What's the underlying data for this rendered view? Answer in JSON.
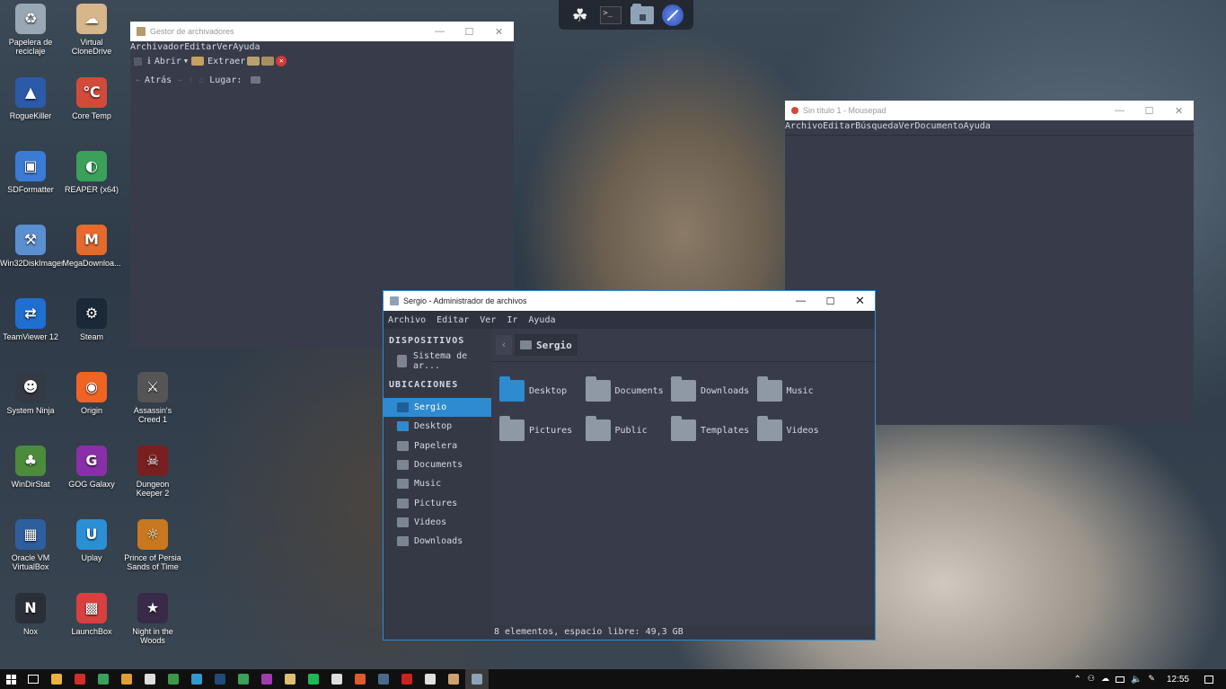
{
  "desktop_icons": [
    {
      "label": "Papelera de reciclaje",
      "icon": "recycle-bin-icon",
      "color": "#9aa7b5"
    },
    {
      "label": "Virtual CloneDrive",
      "icon": "sheep-icon",
      "color": "#d6b68a"
    },
    {
      "label": "RogueKiller",
      "icon": "roguekiller-icon",
      "color": "#2b5aa8"
    },
    {
      "label": "Core Temp",
      "icon": "thermometer-icon",
      "color": "#d24a3a"
    },
    {
      "label": "SDFormatter",
      "icon": "sd-card-icon",
      "color": "#3a7bd5"
    },
    {
      "label": "REAPER (x64)",
      "icon": "reaper-icon",
      "color": "#3aa05a"
    },
    {
      "label": "Win32DiskImager",
      "icon": "disk-imager-icon",
      "color": "#5a8fd0"
    },
    {
      "label": "MegaDownloa...",
      "icon": "mega-icon",
      "color": "#e56a2b"
    },
    {
      "label": "TeamViewer 12",
      "icon": "teamviewer-icon",
      "color": "#1f6fd1"
    },
    {
      "label": "Steam",
      "icon": "steam-icon",
      "color": "#1b2838"
    },
    {
      "label": "System Ninja",
      "icon": "ninja-icon",
      "color": "#333a44"
    },
    {
      "label": "Origin",
      "icon": "origin-icon",
      "color": "#f06423"
    },
    {
      "label": "Assassin's Creed 1",
      "icon": "assassins-creed-icon",
      "color": "#555555"
    },
    {
      "label": "WinDirStat",
      "icon": "tree-icon",
      "color": "#4c8a3c"
    },
    {
      "label": "GOG Galaxy",
      "icon": "gog-icon",
      "color": "#8a2fa8"
    },
    {
      "label": "Dungeon Keeper 2",
      "icon": "dungeon-keeper-icon",
      "color": "#7a1f1f"
    },
    {
      "label": "Oracle VM VirtualBox",
      "icon": "virtualbox-icon",
      "color": "#2d5f9e"
    },
    {
      "label": "Uplay",
      "icon": "uplay-icon",
      "color": "#2b8fd6"
    },
    {
      "label": "Prince of Persia Sands of Time",
      "icon": "prince-of-persia-icon",
      "color": "#c8781e"
    },
    {
      "label": "Nox",
      "icon": "nox-icon",
      "color": "#2a2f38"
    },
    {
      "label": "LaunchBox",
      "icon": "launchbox-icon",
      "color": "#d93f3f"
    },
    {
      "label": "Night in the Woods",
      "icon": "night-in-woods-icon",
      "color": "#3a2a4a"
    }
  ],
  "dock": [
    "swan-icon",
    "terminal-icon",
    "folder-home-icon",
    "compass-icon"
  ],
  "archive_manager": {
    "title": "Gestor de archivadores",
    "menu": "ArchivadorEditarVerAyuda",
    "toolbar": {
      "open": "Abrir",
      "extract": "Extraer"
    },
    "nav": {
      "back": "Atrás",
      "location": "Lugar:"
    }
  },
  "mousepad": {
    "title": "Sin título 1 - Mousepad",
    "menu": "ArchivoEditarBúsquedaVerDocumentoAyuda"
  },
  "file_manager": {
    "title": "Sergio - Administrador de archivos",
    "menu": [
      "Archivo",
      "Editar",
      "Ver",
      "Ir",
      "Ayuda"
    ],
    "devices_heading": "DISPOSITIVOS",
    "devices": [
      "Sistema de ar..."
    ],
    "places_heading": "UBICACIONES",
    "places": [
      "Sergio",
      "Desktop",
      "Papelera",
      "Documents",
      "Music",
      "Pictures",
      "Videos",
      "Downloads"
    ],
    "path_crumb": "Sergio",
    "folders": [
      {
        "name": "Desktop",
        "icon": "desktop-folder-icon"
      },
      {
        "name": "Documents",
        "icon": "documents-folder-icon"
      },
      {
        "name": "Downloads",
        "icon": "downloads-folder-icon"
      },
      {
        "name": "Music",
        "icon": "music-folder-icon"
      },
      {
        "name": "Pictures",
        "icon": "pictures-folder-icon"
      },
      {
        "name": "Public",
        "icon": "public-folder-icon"
      },
      {
        "name": "Templates",
        "icon": "templates-folder-icon"
      },
      {
        "name": "Videos",
        "icon": "videos-folder-icon"
      }
    ],
    "status": "8 elementos, espacio libre: 49,3 GB"
  },
  "taskbar": {
    "clock": "12:55",
    "accent": "#2e8bd0"
  }
}
